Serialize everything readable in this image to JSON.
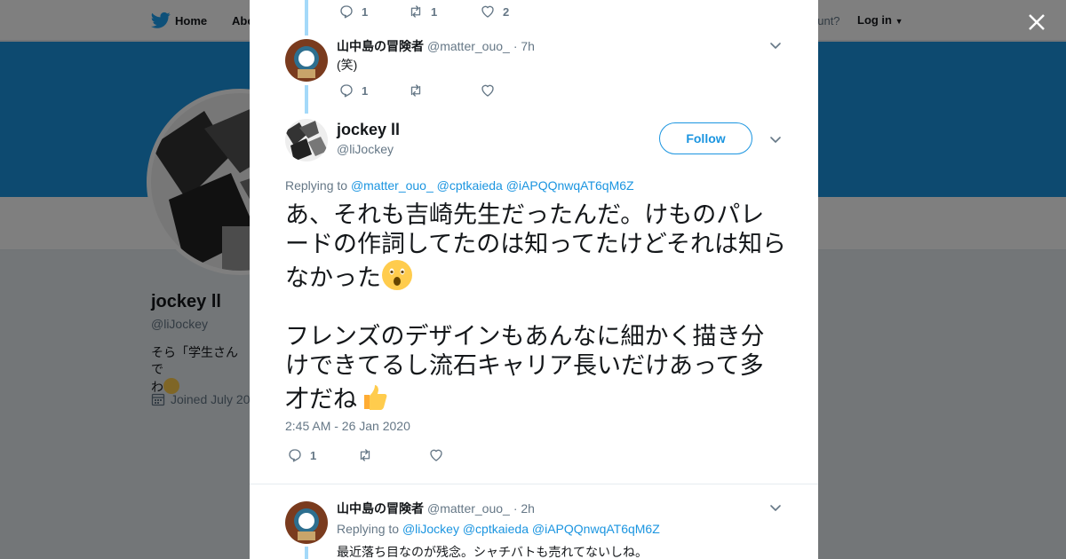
{
  "nav": {
    "home_label": "Home",
    "about_label": "Abo",
    "account_prompt": "ccount?",
    "login_label": "Log in"
  },
  "profile": {
    "name": "jockey ll",
    "handle": "@liJockey",
    "bio": "そら「学生さんで",
    "bio_line2": "わ",
    "joined": "Joined July 20"
  },
  "colors": {
    "accent": "#1b95e0",
    "banner": "#1b95e0"
  },
  "thread": {
    "prev_tweet_stats": {
      "replies": "1",
      "retweets": "1",
      "likes": "2"
    },
    "reply1": {
      "name": "山中島の冒険者",
      "handle": "@matter_ouo_",
      "time": "· 7h",
      "text": "(笑)",
      "replies": "1"
    },
    "main": {
      "name": "jockey ll",
      "handle": "@liJockey",
      "follow_label": "Follow",
      "replying_prefix": "Replying to",
      "replying_to": [
        "@matter_ouo_",
        "@cptkaieda",
        "@iAPQQnwqAT6qM6Z"
      ],
      "para1": "あ、それも吉崎先生だったんだ。けものパレードの作詞してたのは知ってたけどそれは知らなかった",
      "para2": "フレンズのデザインもあんなに細かく描き分けできてるし流石キャリア長いだけあって多才だね",
      "timestamp": "2:45 AM - 26 Jan 2020",
      "replies": "1"
    },
    "reply2": {
      "name": "山中島の冒険者",
      "handle": "@matter_ouo_",
      "time": "· 2h",
      "replying_prefix": "Replying to",
      "replying_to": [
        "@liJockey",
        "@cptkaieda",
        "@iAPQQnwqAT6qM6Z"
      ],
      "text": "最近落ち目なのが残念。シャチバトも売れてないしね。"
    }
  }
}
